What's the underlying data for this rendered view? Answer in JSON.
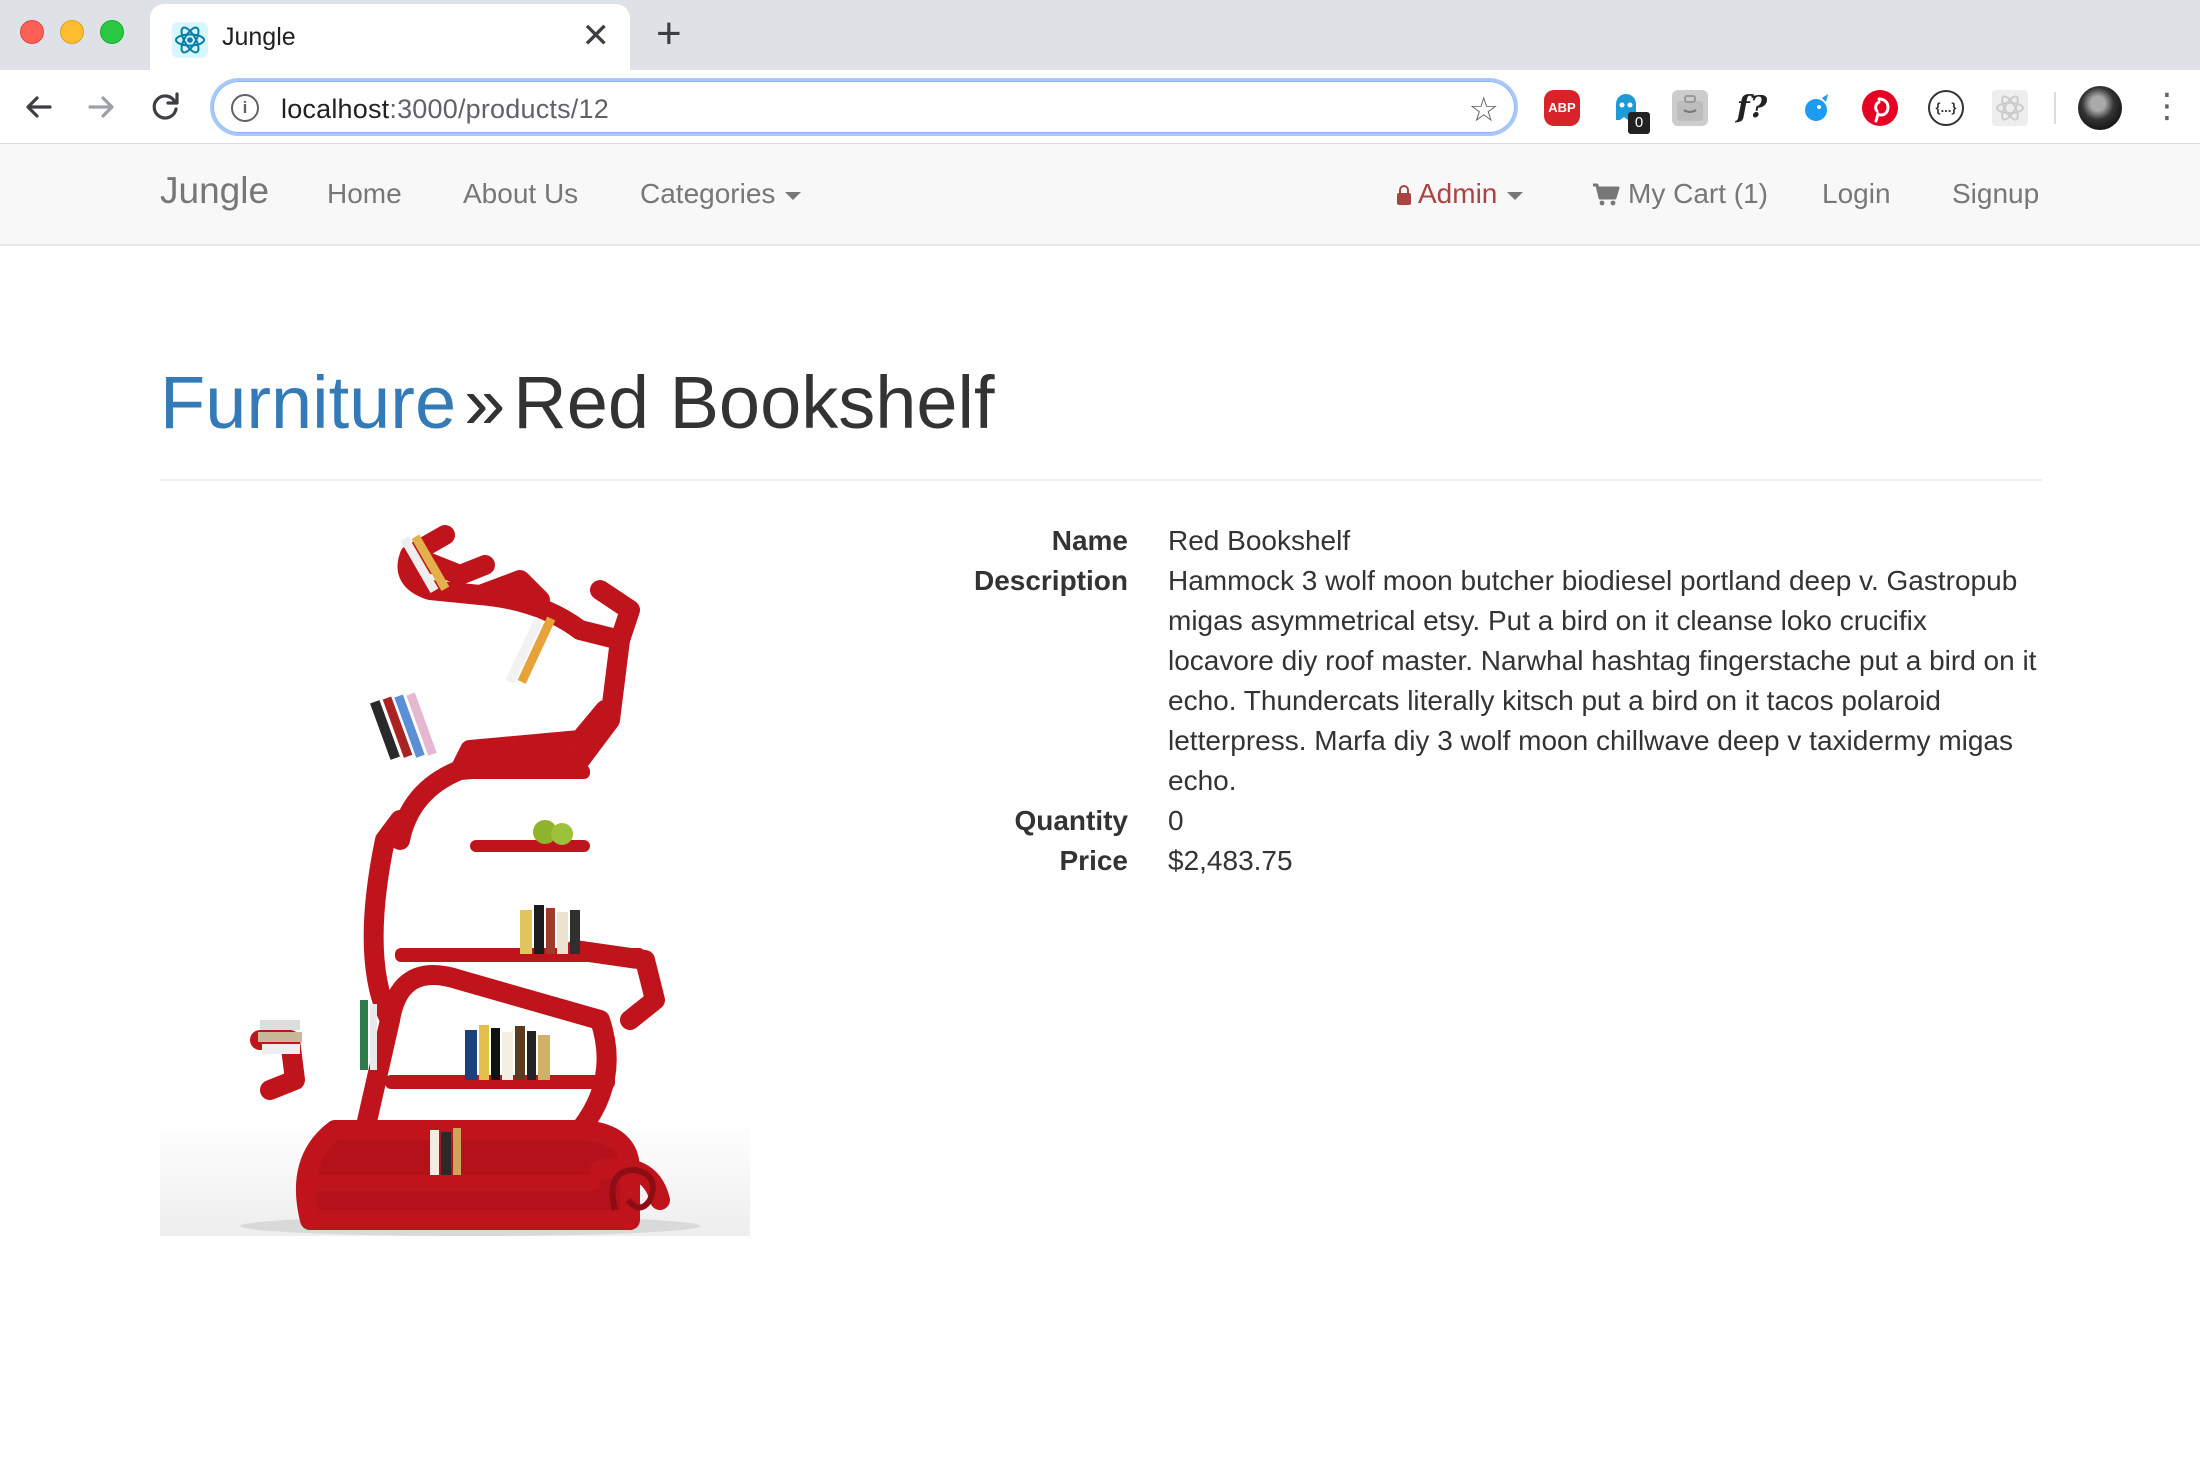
{
  "browser": {
    "tab_title": "Jungle",
    "url_host": "localhost",
    "url_path": ":3000/products/12",
    "extensions": [
      "ABP",
      "0",
      "f?"
    ],
    "colors": {
      "tabbar": "#dee1e6",
      "focus_ring": "#a8c7fa"
    }
  },
  "navbar": {
    "brand": "Jungle",
    "home": "Home",
    "about": "About Us",
    "categories": "Categories",
    "admin": "Admin",
    "cart": "My Cart (1)",
    "login": "Login",
    "signup": "Signup"
  },
  "page": {
    "breadcrumb_category": "Furniture",
    "breadcrumb_separator": "»",
    "product_title": "Red Bookshelf"
  },
  "product": {
    "labels": {
      "name": "Name",
      "description": "Description",
      "quantity": "Quantity",
      "price": "Price"
    },
    "name": "Red Bookshelf",
    "description": "Hammock 3 wolf moon butcher biodiesel portland deep v. Gastropub migas asymmetrical etsy. Put a bird on it cleanse loko crucifix locavore diy roof master. Narwhal hashtag fingerstache put a bird on it echo. Thundercats literally kitsch put a bird on it tacos polaroid letterpress. Marfa diy 3 wolf moon chillwave deep v taxidermy migas echo.",
    "quantity": "0",
    "price": "$2,483.75"
  },
  "theme": {
    "link": "#337ab7",
    "admin": "#a94442",
    "navbar_bg": "#f8f8f8",
    "shelf_red": "#c0141c"
  }
}
